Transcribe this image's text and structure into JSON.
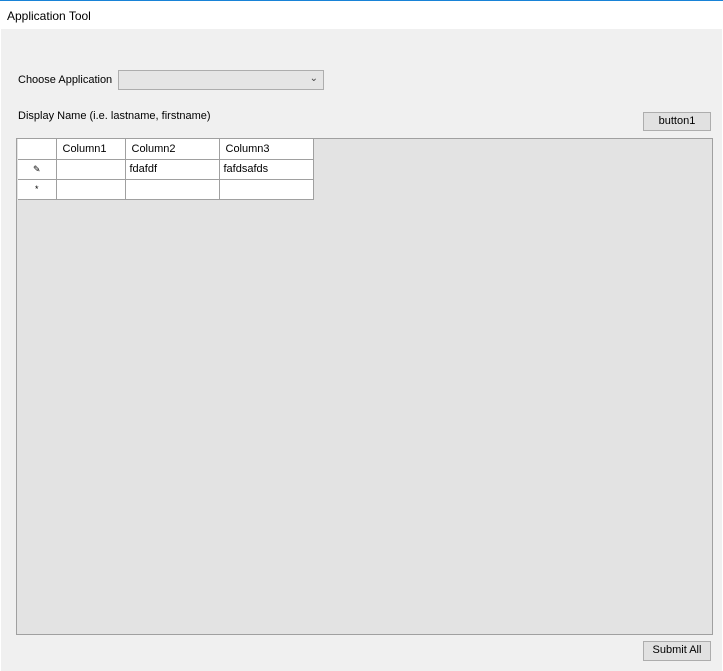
{
  "window": {
    "title": "Application Tool"
  },
  "form": {
    "choose_label": "Choose Application",
    "choose_value": "",
    "display_name_label": "Display Name (i.e. lastname, firstname)",
    "button1": "button1",
    "submit": "Submit All"
  },
  "grid": {
    "columns": [
      "Column1",
      "Column2",
      "Column3"
    ],
    "rows": [
      {
        "indicator": "✎",
        "cells": [
          "",
          "fdafdf",
          "fafdsafds"
        ]
      },
      {
        "indicator": "*",
        "cells": [
          "",
          "",
          ""
        ]
      }
    ]
  }
}
